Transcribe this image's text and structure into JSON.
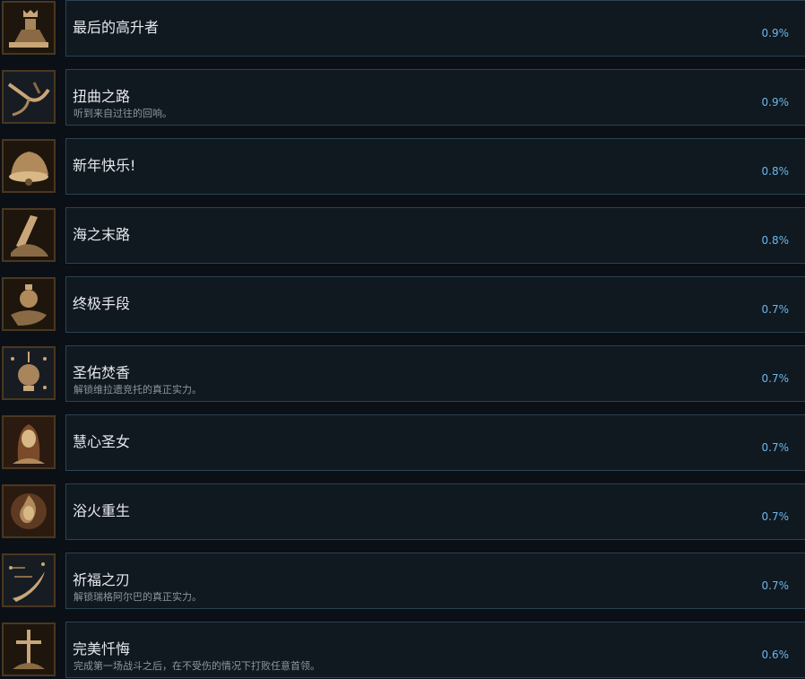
{
  "achievements": [
    {
      "title": "最后的高升者",
      "description": "",
      "percent": "0.9%",
      "icon": "crowned-figure-icon"
    },
    {
      "title": "扭曲之路",
      "description": "听到来自过往的回响。",
      "percent": "0.9%",
      "icon": "twisted-branch-icon"
    },
    {
      "title": "新年快乐!",
      "description": "",
      "percent": "0.8%",
      "icon": "bell-icon"
    },
    {
      "title": "海之末路",
      "description": "",
      "percent": "0.8%",
      "icon": "sea-hand-icon"
    },
    {
      "title": "终极手段",
      "description": "",
      "percent": "0.7%",
      "icon": "urn-hand-icon"
    },
    {
      "title": "圣佑焚香",
      "description": "解锁维拉遗竞托的真正实力。",
      "percent": "0.7%",
      "icon": "censer-icon"
    },
    {
      "title": "慧心圣女",
      "description": "",
      "percent": "0.7%",
      "icon": "saint-portrait-icon"
    },
    {
      "title": "浴火重生",
      "description": "",
      "percent": "0.7%",
      "icon": "rebirth-flame-icon"
    },
    {
      "title": "祈福之刃",
      "description": "解锁瑞格阿尔巴的真正实力。",
      "percent": "0.7%",
      "icon": "blessed-blade-icon"
    },
    {
      "title": "完美忏悔",
      "description": "完成第一场战斗之后，在不受伤的情况下打败任意首领。",
      "percent": "0.6%",
      "icon": "penitent-figure-icon"
    }
  ],
  "colors": {
    "background": "#0b1016",
    "panel": "#101820",
    "panel_border": "#2a4353",
    "title_text": "#e6e9ec",
    "description_text": "#8e979f",
    "percent_text": "#6bb8ea",
    "icon_art": "#c9a679"
  }
}
